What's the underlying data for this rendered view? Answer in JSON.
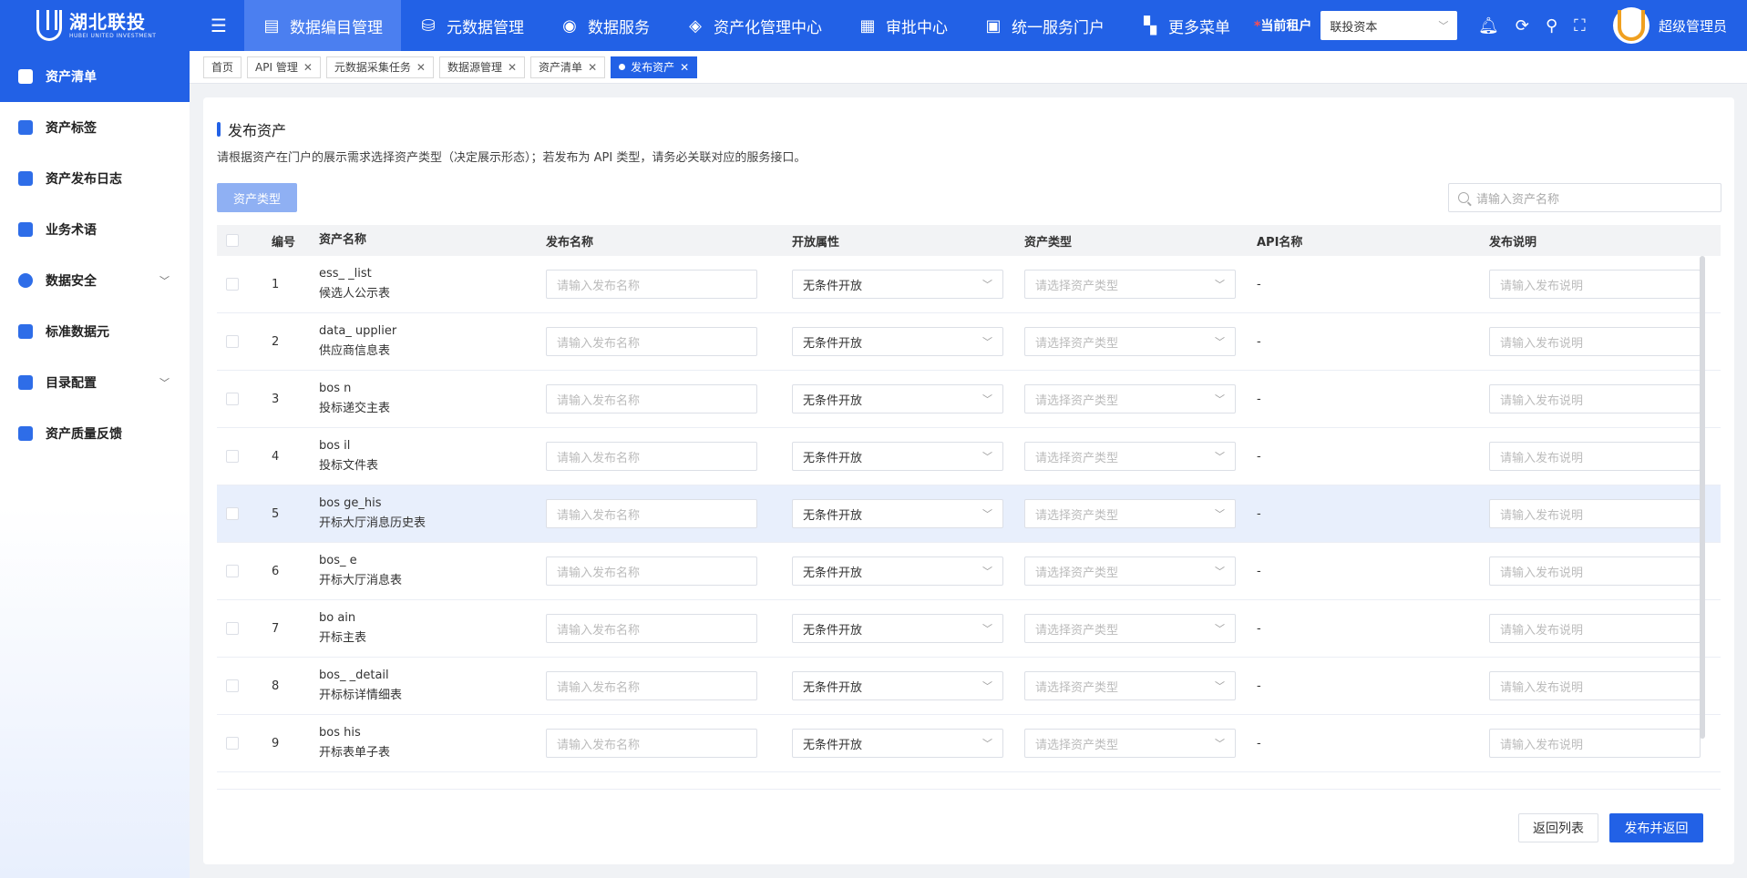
{
  "logo": {
    "cn": "湖北联投",
    "en": "HUBEI UNITED INVESTMENT"
  },
  "nav": [
    {
      "label": "数据编目管理",
      "icon": "catalog-icon"
    },
    {
      "label": "元数据管理",
      "icon": "metadata-icon"
    },
    {
      "label": "数据服务",
      "icon": "data-service-icon"
    },
    {
      "label": "资产化管理中心",
      "icon": "asset-center-icon"
    },
    {
      "label": "审批中心",
      "icon": "approval-icon"
    },
    {
      "label": "统一服务门户",
      "icon": "portal-icon"
    },
    {
      "label": "更多菜单",
      "icon": "more-menu-icon"
    }
  ],
  "tenant": {
    "label": "当前租户",
    "value": "联投资本"
  },
  "user": {
    "name": "超级管理员"
  },
  "sidebar": [
    {
      "label": "资产清单"
    },
    {
      "label": "资产标签"
    },
    {
      "label": "资产发布日志"
    },
    {
      "label": "业务术语"
    },
    {
      "label": "数据安全"
    },
    {
      "label": "标准数据元"
    },
    {
      "label": "目录配置"
    },
    {
      "label": "资产质量反馈"
    }
  ],
  "tabs": [
    {
      "label": "首页"
    },
    {
      "label": "API 管理"
    },
    {
      "label": "元数据采集任务"
    },
    {
      "label": "数据源管理"
    },
    {
      "label": "资产清单"
    },
    {
      "label": "发布资产"
    }
  ],
  "page": {
    "title": "发布资产",
    "description": "请根据资产在门户的展示需求选择资产类型（决定展示形态）；若发布为 API 类型，请务必关联对应的服务接口。",
    "type_button": "资产类型",
    "search_placeholder": "请输入资产名称"
  },
  "table": {
    "headers": {
      "no": "编号",
      "name": "资产名称",
      "pub_name": "发布名称",
      "open": "开放属性",
      "type": "资产类型",
      "api": "API名称",
      "desc": "发布说明"
    },
    "pub_placeholder": "请输入发布名称",
    "type_placeholder": "请选择资产类型",
    "desc_placeholder": "请输入发布说明",
    "rows": [
      {
        "no": "1",
        "code": "ess_              _list",
        "cn": "候选人公示表",
        "open": "无条件开放",
        "api": "-"
      },
      {
        "no": "2",
        "code": "data_                      upplier",
        "cn": "供应商信息表",
        "open": "无条件开放",
        "api": "-"
      },
      {
        "no": "3",
        "code": "bos             n",
        "cn": "投标递交主表",
        "open": "无条件开放",
        "api": "-"
      },
      {
        "no": "4",
        "code": "bos          il",
        "cn": "投标文件表",
        "open": "无条件开放",
        "api": "-"
      },
      {
        "no": "5",
        "code": "bos                    ge_his",
        "cn": "开标大厅消息历史表",
        "open": "无条件开放",
        "api": "-"
      },
      {
        "no": "6",
        "code": "bos_                e",
        "cn": "开标大厅消息表",
        "open": "无条件开放",
        "api": "-"
      },
      {
        "no": "7",
        "code": "bo             ain",
        "cn": "开标主表",
        "open": "无条件开放",
        "api": "-"
      },
      {
        "no": "8",
        "code": "bos_           _detail",
        "cn": "开标标详情细表",
        "open": "无条件开放",
        "api": "-"
      },
      {
        "no": "9",
        "code": "bos                      his",
        "cn": "开标表单子表",
        "open": "无条件开放",
        "api": "-"
      }
    ]
  },
  "footer": {
    "back": "返回列表",
    "publish": "发布并返回"
  },
  "colors": {
    "primary": "#2261e6",
    "highlight_row": "#e8effc"
  }
}
